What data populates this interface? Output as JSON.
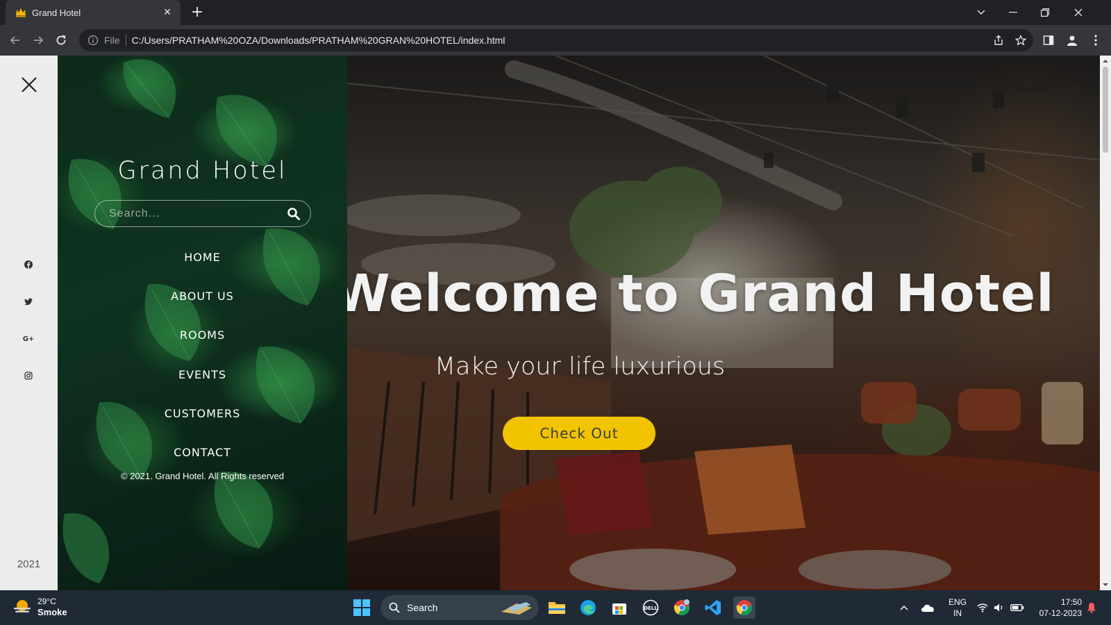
{
  "browser": {
    "tab_title": "Grand Hotel",
    "url_scheme": "File",
    "url": "C:/Users/PRATHAM%20OZA/Downloads/PRATHAM%20GRAN%20HOTEL/index.html"
  },
  "page": {
    "brand": "Grand Hotel",
    "search_placeholder": "Search...",
    "menu": [
      "HOME",
      "ABOUT US",
      "ROOMS",
      "EVENTS",
      "CUSTOMERS",
      "CONTACT"
    ],
    "copyright": "© 2021. Grand Hotel. All Rights reserved",
    "rail_year": "2021",
    "social_icons": [
      "facebook-icon",
      "twitter-icon",
      "google-plus-icon",
      "instagram-icon"
    ],
    "hero_heading": "Welcome to Grand Hotel",
    "hero_tagline": "Make your life luxurious",
    "cta_label": "Check Out",
    "colors": {
      "cta": "#f2c400",
      "rail": "#ececec",
      "leaf_panel": "#0f3321"
    }
  },
  "taskbar": {
    "weather_temp": "29°C",
    "weather_desc": "Smoke",
    "search_label": "Search",
    "lang_line1": "ENG",
    "lang_line2": "IN",
    "time": "17:50",
    "date": "07-12-2023"
  }
}
